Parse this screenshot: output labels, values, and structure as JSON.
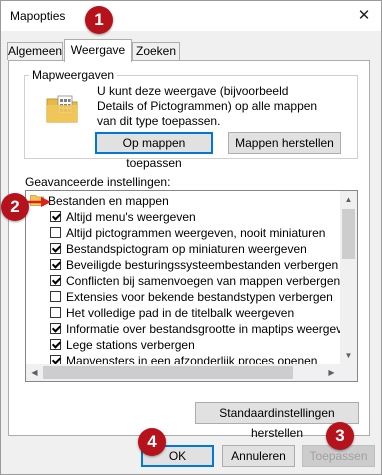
{
  "window": {
    "title": "Mapopties",
    "close_glyph": "✕"
  },
  "tabs": [
    {
      "label": "Algemeen",
      "active": false
    },
    {
      "label": "Weergave",
      "active": true
    },
    {
      "label": "Zoeken",
      "active": false
    }
  ],
  "folder_views": {
    "group_label": "Mapweergaven",
    "description": "U kunt deze weergave (bijvoorbeeld Details of Pictogrammen) op alle mappen van dit type toepassen.",
    "apply_button": "Op mappen toepassen",
    "reset_button": "Mappen herstellen",
    "icon": "folder-icon"
  },
  "advanced": {
    "label": "Geavanceerde instellingen:",
    "category": "Bestanden en mappen",
    "items": [
      {
        "label": "Altijd menu's weergeven",
        "checked": true
      },
      {
        "label": "Altijd pictogrammen weergeven, nooit miniaturen",
        "checked": false
      },
      {
        "label": "Bestandspictogram op miniaturen weergeven",
        "checked": true
      },
      {
        "label": "Beveiligde besturingssysteembestanden verbergen (aanbevolen)",
        "checked": true
      },
      {
        "label": "Conflicten bij samenvoegen van mappen verbergen",
        "checked": true
      },
      {
        "label": "Extensies voor bekende bestandstypen verbergen",
        "checked": false
      },
      {
        "label": "Het volledige pad in de titelbalk weergeven",
        "checked": false
      },
      {
        "label": "Informatie over bestandsgrootte in maptips weergeven",
        "checked": true
      },
      {
        "label": "Lege stations verbergen",
        "checked": true
      },
      {
        "label": "Mapvensters in een afzonderlijk proces openen",
        "checked": true
      }
    ]
  },
  "restore_defaults_button": "Standaardinstellingen herstellen",
  "footer": {
    "ok": "OK",
    "cancel": "Annuleren",
    "apply": "Toepassen"
  },
  "callouts": {
    "c1": "1",
    "c2": "2",
    "c3": "3",
    "c4": "4"
  },
  "colors": {
    "callout": "#b5121b",
    "arrow": "#e0201a",
    "focus": "#0078d7"
  }
}
